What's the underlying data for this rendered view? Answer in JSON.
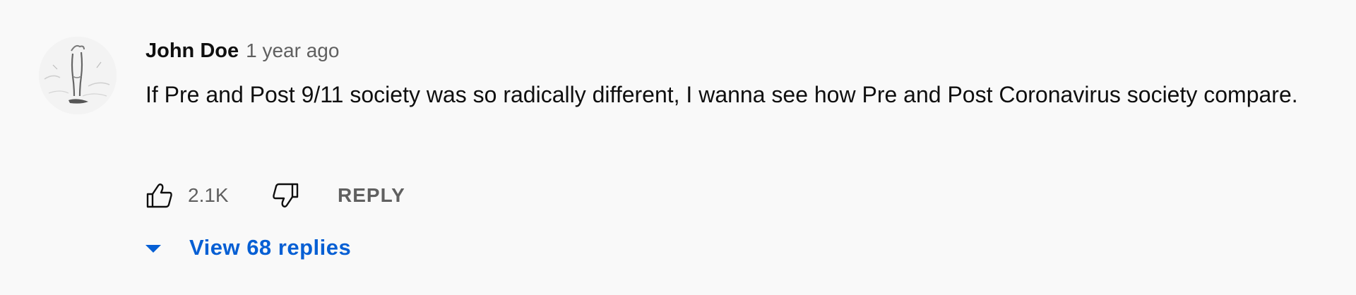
{
  "comment": {
    "avatar_icon": "user-avatar-sketch",
    "author": "John Doe",
    "timestamp": "1 year ago",
    "text": "If Pre and Post 9/11 society was so radically different, I wanna see how Pre and Post Coronavirus society compare.",
    "like_icon": "thumbs-up-icon",
    "like_count": "2.1K",
    "dislike_icon": "thumbs-down-icon",
    "reply_label": "REPLY",
    "replies_toggle_icon": "caret-down-icon",
    "view_replies_label": "View 68 replies"
  },
  "colors": {
    "background": "#f9f9f9",
    "primary_text": "#0f0f0f",
    "secondary_text": "#606060",
    "link_blue": "#065fd4"
  }
}
